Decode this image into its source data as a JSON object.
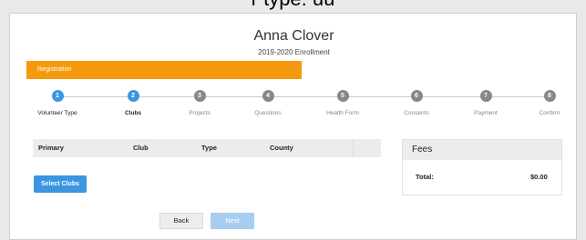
{
  "header": {
    "caption": "r type: uu"
  },
  "student": {
    "name": "Anna Clover",
    "enrollment": "2019-2020 Enrollment"
  },
  "banner": {
    "label": "Registration",
    "color": "#f59a0c"
  },
  "steps": [
    {
      "number": "1",
      "label": "Volunteer Type",
      "state": "done"
    },
    {
      "number": "2",
      "label": "Clubs",
      "state": "current"
    },
    {
      "number": "3",
      "label": "Projects",
      "state": "pending"
    },
    {
      "number": "4",
      "label": "Questions",
      "state": "pending"
    },
    {
      "number": "5",
      "label": "Health Form",
      "state": "pending"
    },
    {
      "number": "6",
      "label": "Consents",
      "state": "pending"
    },
    {
      "number": "7",
      "label": "Payment",
      "state": "pending"
    },
    {
      "number": "8",
      "label": "Confirm",
      "state": "pending"
    }
  ],
  "clubs_table": {
    "columns": [
      "Primary",
      "Club",
      "Type",
      "County",
      ""
    ]
  },
  "select_clubs_label": "Select Clubs",
  "fees": {
    "title": "Fees",
    "total_label": "Total:",
    "total_value": "$0.00"
  },
  "nav": {
    "back_label": "Back",
    "next_label": "Next"
  },
  "colors": {
    "accent": "#3a96e0",
    "pending_step": "#888888",
    "next_disabled": "#a8cdf2"
  }
}
